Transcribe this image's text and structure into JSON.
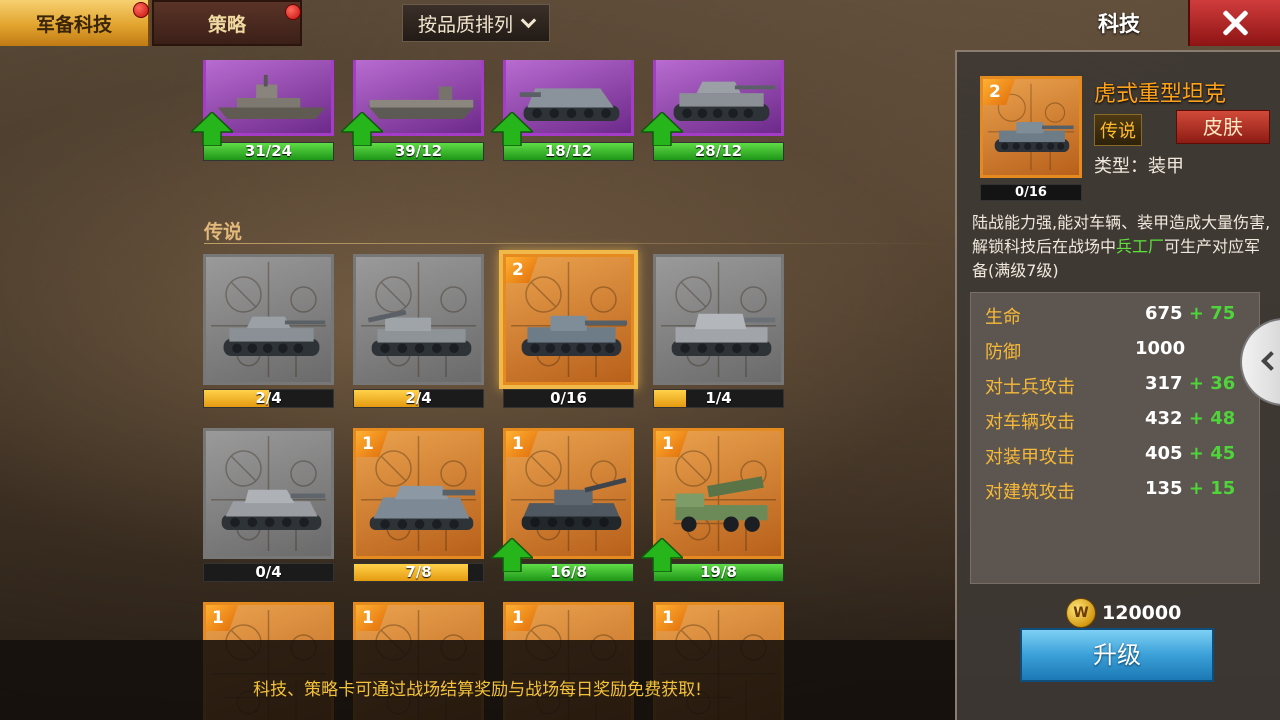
{
  "tabs": [
    {
      "label": "军备科技",
      "active": true,
      "notify": true
    },
    {
      "label": "策略",
      "active": false,
      "notify": true
    }
  ],
  "sort": {
    "label": "按品质排列"
  },
  "panel_title": "科技",
  "section_label": "传说",
  "top_row": [
    {
      "progress": "31/24",
      "fill": 1.0,
      "color": "green",
      "upgrade": true,
      "rarity": "purple",
      "unit": "battleship"
    },
    {
      "progress": "39/12",
      "fill": 1.0,
      "color": "green",
      "upgrade": true,
      "rarity": "purple",
      "unit": "carrier"
    },
    {
      "progress": "18/12",
      "fill": 1.0,
      "color": "green",
      "upgrade": true,
      "rarity": "purple",
      "unit": "tank-destroyer"
    },
    {
      "progress": "28/12",
      "fill": 1.0,
      "color": "green",
      "upgrade": true,
      "rarity": "purple",
      "unit": "tank"
    }
  ],
  "legend_row1": [
    {
      "progress": "2/4",
      "fill": 0.5,
      "color": "yellow",
      "rarity": "gray",
      "level": "",
      "unit": "tank"
    },
    {
      "progress": "2/4",
      "fill": 0.5,
      "color": "yellow",
      "rarity": "gray",
      "level": "",
      "unit": "artillery"
    },
    {
      "progress": "0/16",
      "fill": 0.0,
      "color": "yellow",
      "rarity": "orange",
      "level": "2",
      "selected": true,
      "unit": "tiger"
    },
    {
      "progress": "1/4",
      "fill": 0.25,
      "color": "yellow",
      "rarity": "gray",
      "level": "",
      "unit": "heavy-tank"
    }
  ],
  "legend_row2": [
    {
      "progress": "0/4",
      "fill": 0.0,
      "color": "yellow",
      "rarity": "gray",
      "level": "",
      "unit": "king-tiger"
    },
    {
      "progress": "7/8",
      "fill": 0.875,
      "color": "yellow",
      "rarity": "orange",
      "level": "1",
      "unit": "maus"
    },
    {
      "progress": "16/8",
      "fill": 1.0,
      "color": "green",
      "rarity": "orange",
      "level": "1",
      "upgrade": true,
      "unit": "e100"
    },
    {
      "progress": "19/8",
      "fill": 1.0,
      "color": "green",
      "rarity": "orange",
      "level": "1",
      "upgrade": true,
      "unit": "katyusha"
    }
  ],
  "legend_row3": [
    {
      "rarity": "orange",
      "level": "1"
    },
    {
      "rarity": "orange",
      "level": "1"
    },
    {
      "rarity": "orange",
      "level": "1"
    },
    {
      "rarity": "orange",
      "level": "1"
    }
  ],
  "hint": "科技、策略卡可通过战场结算奖励与战场每日奖励免费获取!",
  "detail": {
    "level": "2",
    "progress": "0/16",
    "name": "虎式重型坦克",
    "rarity": "传说",
    "skin_label": "皮肤",
    "type": "类型：装甲",
    "desc_before": "陆战能力强,能对车辆、装甲造成大量伤害,解锁科技后在战场中",
    "desc_highlight": "兵工厂",
    "desc_after": "可生产对应军备(满级7级)",
    "stats": [
      {
        "name": "生命",
        "value": "675",
        "bonus": "+ 75"
      },
      {
        "name": "防御",
        "value": "1000",
        "bonus": ""
      },
      {
        "name": "对士兵攻击",
        "value": "317",
        "bonus": "+ 36"
      },
      {
        "name": "对车辆攻击",
        "value": "432",
        "bonus": "+ 48"
      },
      {
        "name": "对装甲攻击",
        "value": "405",
        "bonus": "+ 45"
      },
      {
        "name": "对建筑攻击",
        "value": "135",
        "bonus": "+ 15"
      }
    ],
    "cost": "120000",
    "upgrade_label": "升级"
  },
  "colors": {
    "accent": "#e2a42e",
    "legend_orange": "#e48a1e",
    "epic_purple": "#a53cc8",
    "bonus_green": "#4fd43a",
    "highlight_green": "#5ee33d"
  }
}
